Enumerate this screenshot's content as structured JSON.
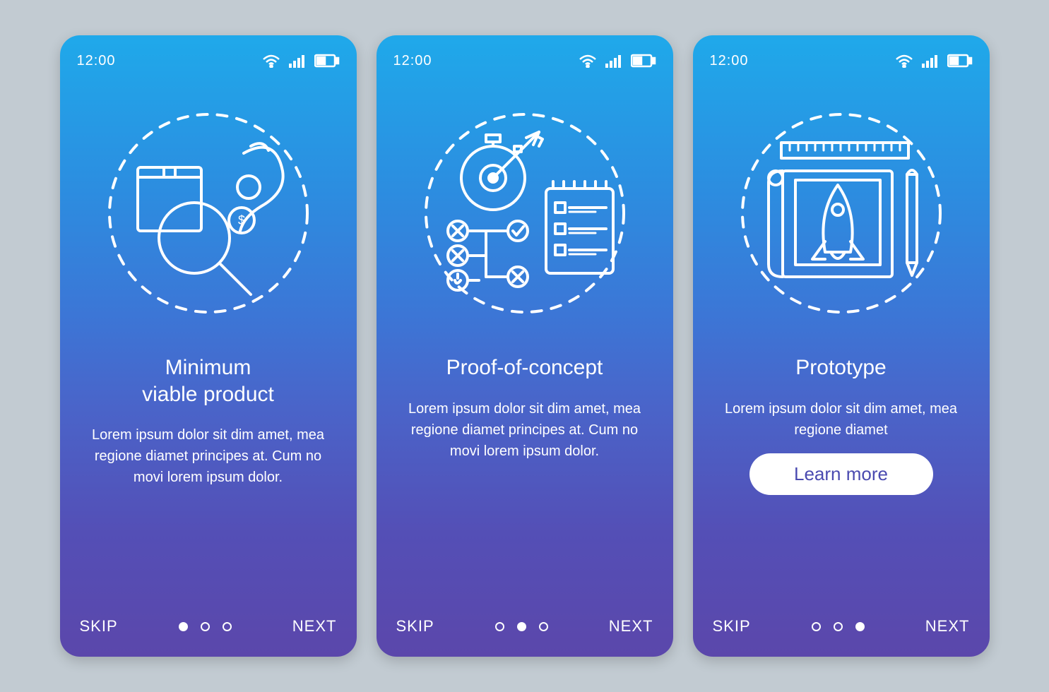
{
  "statusbar": {
    "time": "12:00"
  },
  "screens": [
    {
      "title": "Minimum\nviable product",
      "description": "Lorem ipsum dolor sit dim amet, mea regione diamet principes at. Cum no movi lorem ipsum dolor.",
      "skip": "SKIP",
      "next": "NEXT",
      "learn_more": null,
      "active_dot": 0
    },
    {
      "title": "Proof-of-concept",
      "description": "Lorem ipsum dolor sit dim amet, mea regione diamet principes at. Cum no movi lorem ipsum dolor.",
      "skip": "SKIP",
      "next": "NEXT",
      "learn_more": null,
      "active_dot": 1
    },
    {
      "title": "Prototype",
      "description": "Lorem ipsum dolor sit dim amet, mea regione diamet",
      "skip": "SKIP",
      "next": "NEXT",
      "learn_more": "Learn more",
      "active_dot": 2
    }
  ]
}
